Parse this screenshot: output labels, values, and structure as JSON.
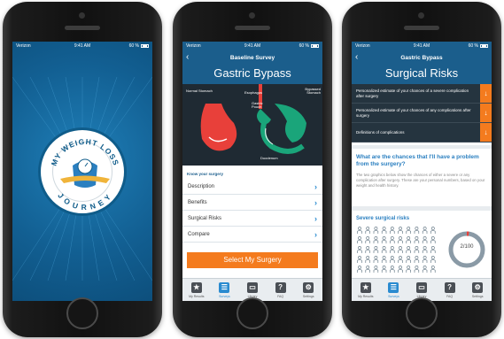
{
  "status": {
    "carrier": "Verizon",
    "time": "9:41 AM",
    "battery": "60 %"
  },
  "splash": {
    "logo_text_top": "MY WEIGHT LOSS",
    "logo_text_bottom": "JOURNEY"
  },
  "baseline": {
    "nav_title": "Baseline Survey",
    "page_title": "Gastric Bypass",
    "illustration_labels": {
      "normal_stomach": "Normal Stomach",
      "esophagus": "Esophagus",
      "gastric_pouch": "Gastric Pouch",
      "bypassed_stomach": "Bypassed Stomach",
      "duodenum": "Duodenum"
    },
    "section_label": "Know your surgery",
    "menu": [
      {
        "label": "Description"
      },
      {
        "label": "Benefits"
      },
      {
        "label": "Surgical Risks"
      },
      {
        "label": "Compare"
      }
    ],
    "cta_label": "Select My Surgery"
  },
  "surgical_risks": {
    "nav_title": "Gastric Bypass",
    "page_title": "Surgical Risks",
    "rows": [
      {
        "label": "Personalized estimate of your chances of a severe complication after surgery"
      },
      {
        "label": "Personalized estimate of your chances of any complications after surgery"
      },
      {
        "label": "Definitions of complications"
      }
    ],
    "question_heading": "What are the chances that I'll have a problem from the surgery?",
    "question_body": "The two graphics below show the chances of either a severe or any complication after surgery. These are your personal numbers, based on your weight and health history.",
    "severe_heading": "Severe surgical risks",
    "risk_count": 2,
    "risk_total": 100,
    "risk_label": "2/100"
  },
  "tabbar": [
    {
      "label": "My Results",
      "icon": "star-icon"
    },
    {
      "label": "Surveys",
      "icon": "list-icon"
    },
    {
      "label": "Library",
      "icon": "library-icon"
    },
    {
      "label": "FAQ",
      "icon": "question-icon"
    },
    {
      "label": "Settings",
      "icon": "gear-icon"
    }
  ],
  "colors": {
    "brand_blue": "#1b5e8c",
    "accent_orange": "#f47b1e",
    "link_blue": "#2a8bd0"
  }
}
